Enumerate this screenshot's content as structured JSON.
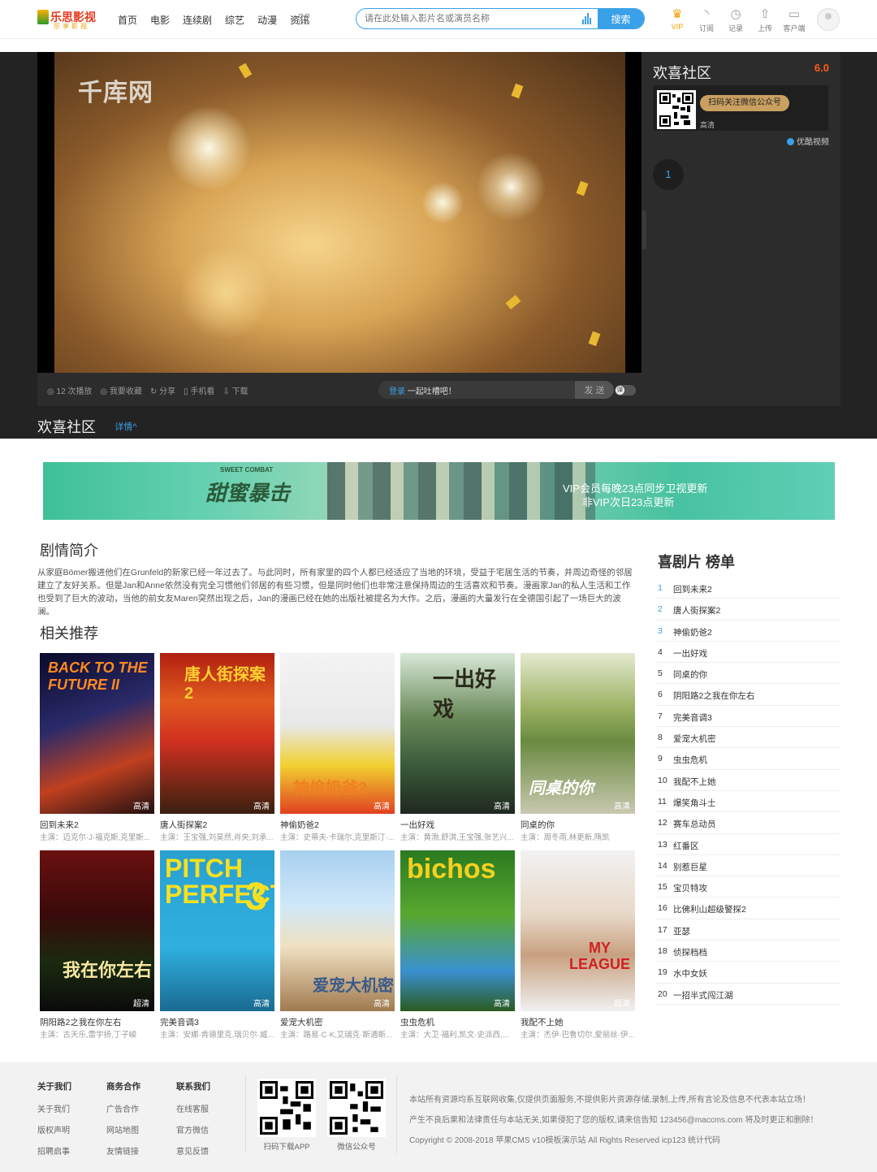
{
  "header": {
    "logo_main": "乐思",
    "logo_accent": "影视",
    "logo_sub": "乐享影视",
    "nav": [
      "首页",
      "电影",
      "连续剧",
      "综艺",
      "动漫",
      "资讯"
    ],
    "search_placeholder": "请在此处输入影片名或演员名称",
    "search_button": "搜索",
    "icons": [
      {
        "label": "VIP",
        "icon": "crown-icon"
      },
      {
        "label": "订阅",
        "icon": "rss-icon"
      },
      {
        "label": "记录",
        "icon": "clock-icon"
      },
      {
        "label": "上传",
        "icon": "upload-icon"
      },
      {
        "label": "客户端",
        "icon": "monitor-icon"
      }
    ]
  },
  "player": {
    "watermark": "千库网",
    "controls": [
      "12 次播放",
      "我要收藏",
      "分享",
      "手机看",
      "下载"
    ],
    "danmu_login": "登录",
    "danmu_tip": "一起吐槽吧！",
    "danmu_send": "发 送",
    "sidebar_title": "欢喜社区",
    "score": "6.0",
    "qr_button": "扫码关注微信公众号",
    "quality": "高清",
    "source": "优酷视频",
    "episode": "1",
    "title": "欢喜社区",
    "details_link": "详情^"
  },
  "banner": {
    "title": "甜蜜暴击",
    "subtitle": "SWEET COMBAT",
    "line1": "VIP会员每晚23点同步卫视更新",
    "line2": "非VIP次日23点更新"
  },
  "synopsis": {
    "heading": "剧情简介",
    "text": "从家庭Bömer搬进他们在Grunfeld的新家已经一年过去了。与此同时，所有家里的四个人都已经适应了当地的环境，受益于宅居生活的节奏，并周边奇怪的邻居建立了友好关系。但是Jan和Anne依然没有完全习惯他们邻居的有些习惯，但是同时他们也非常注意保持周边的生活喜欢和节奏。漫画家Jan的私人生活和工作也受到了巨大的波动，当他的前女友Maren突然出现之后，Jan的漫画已经在她的出版社被提名为大作。之后，漫画的大量发行在全德国引起了一场巨大的波澜。"
  },
  "related": {
    "heading": "相关推荐",
    "items": [
      {
        "title": "回到未来2",
        "actors": "主演：迈克尔·J·福克斯,克里斯...",
        "tag": "高清"
      },
      {
        "title": "唐人街探案2",
        "actors": "主演：王宝强,刘昊然,肖央,刘承...",
        "tag": "高清"
      },
      {
        "title": "神偷奶爸2",
        "actors": "主演：史蒂夫·卡瑞尔,克里斯汀·...",
        "tag": "高清"
      },
      {
        "title": "一出好戏",
        "actors": "主演：黄渤,舒淇,王宝强,张艺兴...",
        "tag": "高清"
      },
      {
        "title": "同桌的你",
        "actors": "主演：周冬雨,林更新,隋凯",
        "tag": "高清"
      },
      {
        "title": "阴阳路2之我在你左右",
        "actors": "主演：古天乐,雷宇扬,丁子峻",
        "tag": "超清"
      },
      {
        "title": "完美音调3",
        "actors": "主演：安娜·肯德里克,瑞贝尔·威...",
        "tag": "高清"
      },
      {
        "title": "爱宠大机密",
        "actors": "主演：路易·C·K,艾瑞克·斯通斯...",
        "tag": "高清"
      },
      {
        "title": "虫虫危机",
        "actors": "主演：大卫·福利,凯文·史派西,...",
        "tag": "高清"
      },
      {
        "title": "我配不上她",
        "actors": "主演：杰伊·巴鲁切尔,爱丽丝·伊...",
        "tag": "超清"
      }
    ]
  },
  "ranking": {
    "heading": "喜剧片 榜单",
    "items": [
      "回到未来2",
      "唐人街探案2",
      "神偷奶爸2",
      "一出好戏",
      "同桌的你",
      "阴阳路2之我在你左右",
      "完美音调3",
      "爱宠大机密",
      "虫虫危机",
      "我配不上她",
      "爆笑角斗士",
      "赛车总动员",
      "红番区",
      "别惹巨星",
      "宝贝特攻",
      "比佛利山超级警探2",
      "亚瑟",
      "侦探档档",
      "水中女妖",
      "一招半式闯江湖"
    ]
  },
  "footer": {
    "columns": [
      {
        "title": "关于我们",
        "links": [
          "关于我们",
          "版权声明",
          "招聘启事"
        ]
      },
      {
        "title": "商务合作",
        "links": [
          "广告合作",
          "网站地图",
          "友情链接"
        ]
      },
      {
        "title": "联系我们",
        "links": [
          "在线客服",
          "官方微信",
          "意见反馈"
        ]
      }
    ],
    "qr_app": "扫码下载APP",
    "qr_wechat": "微信公众号",
    "line1": "本站所有资源均系互联网收集,仅提供页面服务,不提供影片资源存储,录制,上传,所有言论及信息不代表本站立场！",
    "line2": "产生不良后果和法律责任与本站无关,如果侵犯了您的版权,请来信告知 123456@maccms.com 将及时更正和删除！",
    "line3": "Copyright © 2008-2018 苹果CMS v10模板演示站 All Rights Reserved icp123 统计代码"
  }
}
